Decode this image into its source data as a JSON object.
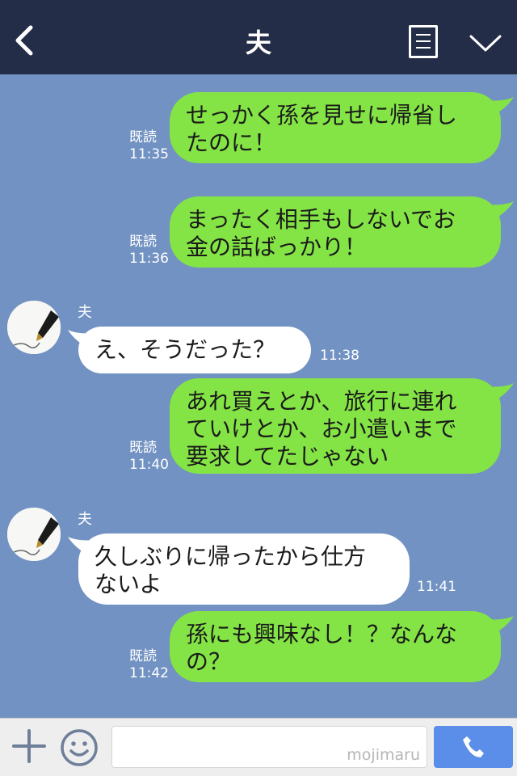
{
  "header": {
    "title": "夫",
    "back_icon": "chevron-left-icon",
    "notes_icon": "notes-icon",
    "menu_icon": "chevron-down-icon"
  },
  "messages": [
    {
      "side": "out",
      "text": "せっかく孫を見せに帰省し\nたのに！",
      "read": "既読",
      "time": "11:35"
    },
    {
      "side": "out",
      "text": "まったく相手もしないでお\n金の話ばっかり！",
      "read": "既読",
      "time": "11:36"
    },
    {
      "side": "in",
      "sender": "夫",
      "text": "え、そうだった？",
      "time": "11:38"
    },
    {
      "side": "out",
      "text": "あれ買えとか、旅行に連れ\nていけとか、お小遣いまで\n要求してたじゃない",
      "read": "既読",
      "time": "11:40"
    },
    {
      "side": "in",
      "sender": "夫",
      "text": "久しぶりに帰ったから仕方\nないよ",
      "time": "11:41"
    },
    {
      "side": "out",
      "text": "孫にも興味なし！？なんな\nの？",
      "read": "既読",
      "time": "11:42"
    }
  ],
  "footer": {
    "input_value": "",
    "watermark": "mojimaru",
    "plus_icon": "plus-icon",
    "emoji_icon": "smiley-icon",
    "call_icon": "phone-icon"
  },
  "colors": {
    "header_bg": "#232d47",
    "chat_bg": "#7192c2",
    "outgoing_bubble": "#84e445",
    "incoming_bubble": "#ffffff",
    "call_button": "#5b8ee9"
  }
}
